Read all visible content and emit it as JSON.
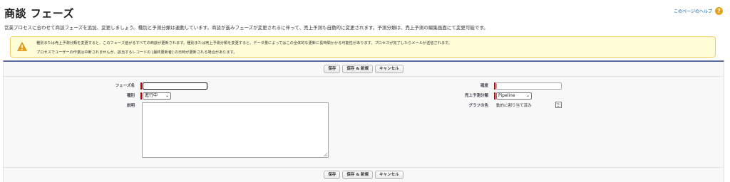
{
  "header": {
    "title": "商談 フェーズ",
    "help_link": "このページのヘルプ",
    "help_icon": "help-icon"
  },
  "intro_text": "営業プロセスに合わせて商談フェーズを追加、変更しましょう。種別と予測分類は連動しています。商談が進みフェーズが変更されるに伴って、売上予測も自動的に変更されます。予測分類は、売上予測の編集画面にて変更可能です。",
  "warning": {
    "icon": "warning-icon",
    "line1": "種別または売上予測分類を変更すると、このフェーズ値がるすべての商談が更新されます。種別または売上予測分類を変更すると、データ量によってはこの全体的な更新に長時間かかる可能性があります。プロセスが完了したらメールが送信されます。",
    "line2": "プロセスでユーザーの作業は中断されませんが、該当するレコードの [最終更新者] の日時が更新される場合があります。"
  },
  "buttons": {
    "save": "保存",
    "save_new": "保存 & 新規",
    "cancel": "キャンセル"
  },
  "form": {
    "phase_name_label": "フェーズ名",
    "phase_name_value": "",
    "type_label": "種別",
    "type_value": "進行中",
    "description_label": "説明",
    "description_value": "",
    "probability_label": "確度",
    "probability_value": "",
    "forecast_label": "売上予測分類",
    "forecast_value": "Pipeline",
    "graph_color_label": "グラフの色",
    "graph_color_value": "動的に割り当て済み"
  },
  "colors": {
    "accent_bar": "#5c6b9d",
    "required": "#cc0000",
    "warning_bg": "#fffdd8",
    "help_icon": "#e3a21a"
  }
}
